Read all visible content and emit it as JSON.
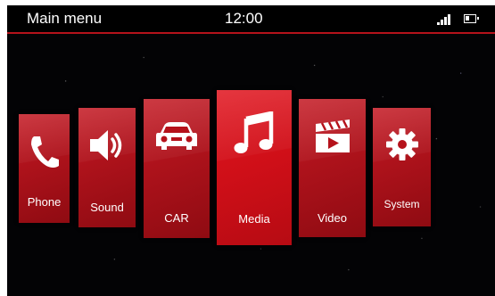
{
  "header": {
    "title": "Main menu",
    "time": "12:00",
    "signal_icon": "signal-bars-icon",
    "battery_icon": "battery-icon"
  },
  "menu": {
    "items": [
      {
        "label": "Phone",
        "icon": "phone-icon",
        "active": false
      },
      {
        "label": "Sound",
        "icon": "speaker-icon",
        "active": false
      },
      {
        "label": "CAR",
        "icon": "car-icon",
        "active": false
      },
      {
        "label": "Media",
        "icon": "music-note-icon",
        "active": true
      },
      {
        "label": "Video",
        "icon": "clapperboard-icon",
        "active": false
      },
      {
        "label": "System",
        "icon": "gear-icon",
        "active": false
      }
    ]
  },
  "colors": {
    "tile_red": "#ad121b",
    "tile_active_red": "#d40f18",
    "header_rule": "#b5121b",
    "background": "#030305"
  }
}
